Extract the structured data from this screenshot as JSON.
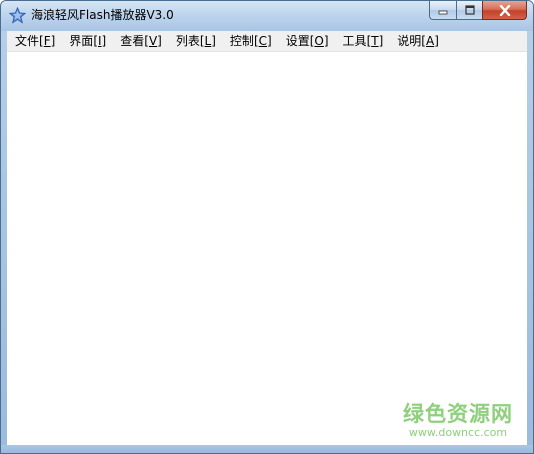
{
  "window": {
    "title": "海浪轻风Flash播放器V3.0",
    "icon": "star-icon"
  },
  "menu": [
    {
      "label": "文件",
      "key": "F"
    },
    {
      "label": "界面",
      "key": "I"
    },
    {
      "label": "查看",
      "key": "V"
    },
    {
      "label": "列表",
      "key": "L"
    },
    {
      "label": "控制",
      "key": "C"
    },
    {
      "label": "设置",
      "key": "O"
    },
    {
      "label": "工具",
      "key": "T"
    },
    {
      "label": "说明",
      "key": "A"
    }
  ],
  "watermark": {
    "title": "绿色资源网",
    "url": "www.downcc.com"
  },
  "colors": {
    "frame": "#a9c6e4",
    "menubar": "#f0f0f0",
    "close_button": "#c2432a",
    "watermark": "#8fcf7d"
  }
}
